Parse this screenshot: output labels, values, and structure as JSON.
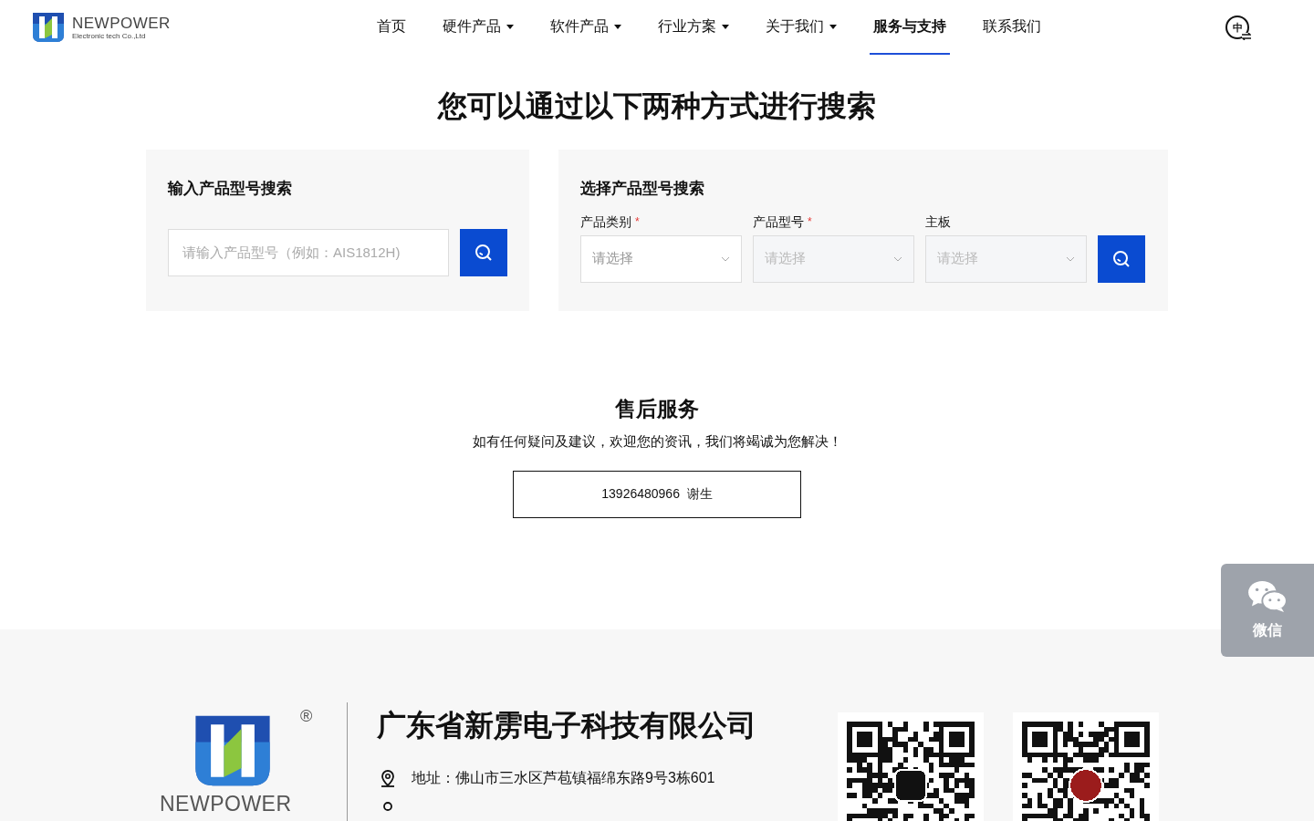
{
  "header": {
    "logo": {
      "name": "NEWPOWER",
      "tagline": "Electronic tech Co.,Ltd"
    },
    "nav": [
      {
        "label": "首页",
        "dropdown": false,
        "selected": false
      },
      {
        "label": "硬件产品",
        "dropdown": true,
        "selected": false
      },
      {
        "label": "软件产品",
        "dropdown": true,
        "selected": false
      },
      {
        "label": "行业方案",
        "dropdown": true,
        "selected": false
      },
      {
        "label": "关于我们",
        "dropdown": true,
        "selected": false
      },
      {
        "label": "服务与支持",
        "dropdown": false,
        "selected": true
      },
      {
        "label": "联系我们",
        "dropdown": false,
        "selected": false
      }
    ]
  },
  "search": {
    "title": "您可以通过以下两种方式进行搜索",
    "by_input": {
      "title": "输入产品型号搜索",
      "placeholder": "请输入产品型号（例如：AIS1812H)"
    },
    "by_select": {
      "title": "选择产品型号搜索",
      "fields": [
        {
          "label": "产品类别",
          "required": true,
          "required_mark": "*",
          "placeholder": "请选择",
          "disabled": false
        },
        {
          "label": "产品型号",
          "required": true,
          "required_mark": "*",
          "placeholder": "请选择",
          "disabled": true
        },
        {
          "label": "主板",
          "required": false,
          "placeholder": "请选择",
          "disabled": true
        }
      ]
    }
  },
  "service": {
    "title": "售后服务",
    "text": "如有任何疑问及建议，欢迎您的资讯，我们将竭诚为您解决！",
    "contact": "13926480966  谢生"
  },
  "float": {
    "label": "微信"
  },
  "language_switch": {
    "label": "中"
  },
  "footer": {
    "logo": {
      "name": "NEWPOWER",
      "registered": "®"
    },
    "company": "广东省新雳电子科技有限公司",
    "address": "地址：佛山市三水区芦苞镇福绵东路9号3栋601"
  }
}
